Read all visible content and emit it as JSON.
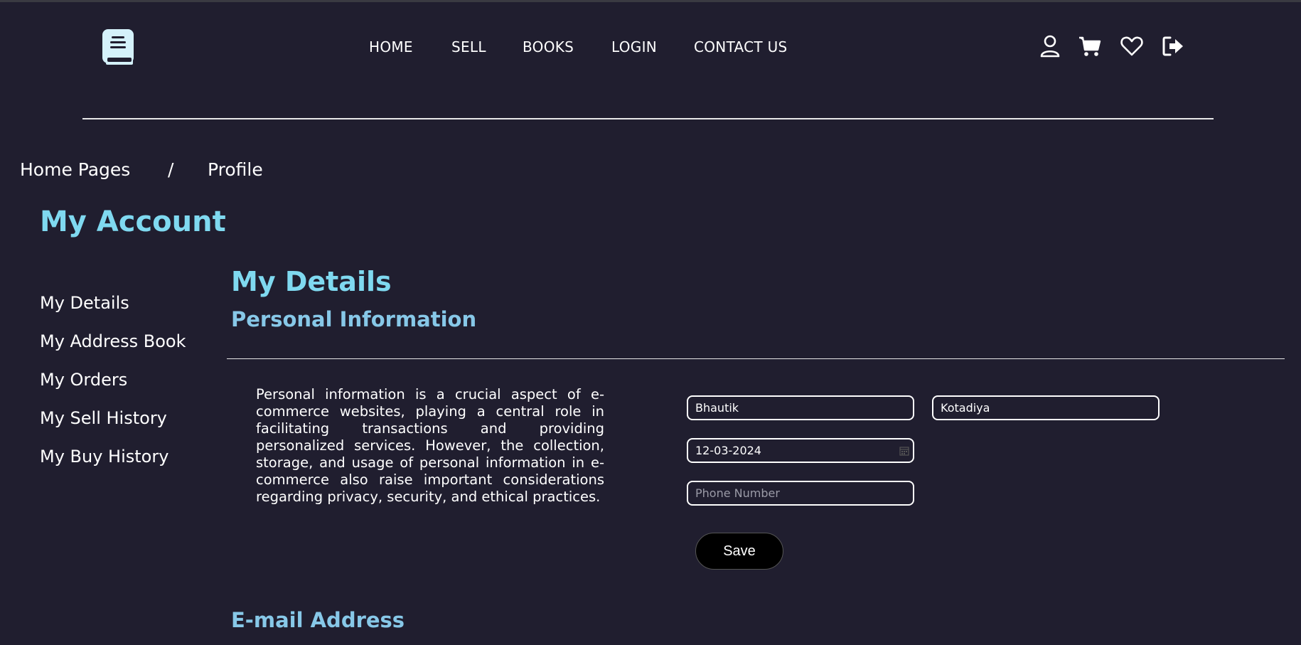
{
  "header": {
    "nav": [
      "HOME",
      "SELL",
      "BOOKS",
      "LOGIN",
      "CONTACT US"
    ],
    "icons": [
      "user-icon",
      "cart-icon",
      "heart-icon",
      "logout-icon"
    ]
  },
  "breadcrumb": {
    "home": "Home Pages",
    "separator": "/",
    "current": "Profile"
  },
  "sidebar": {
    "title": "My Account",
    "items": [
      {
        "label": "My Details"
      },
      {
        "label": "My Address Book"
      },
      {
        "label": "My Orders"
      },
      {
        "label": "My Sell History"
      },
      {
        "label": "My Buy History"
      }
    ]
  },
  "main": {
    "title": "My Details",
    "section_title": "Personal Information",
    "description": "Personal information is a crucial aspect of e-commerce websites, playing a central role in facilitating transactions and providing personalized services. However, the collection, storage, and usage of personal information in e-commerce also raise important considerations regarding privacy, security, and ethical practices.",
    "form": {
      "first_name": "Bhautik",
      "last_name": "Kotadiya",
      "date": "12-03-2024",
      "phone_placeholder": "Phone Number",
      "save_label": "Save"
    },
    "email_section_title": "E-mail Address"
  },
  "colors": {
    "background": "#201e2f",
    "accent": "#7fd9f0",
    "subtitle": "#87c8e8"
  }
}
